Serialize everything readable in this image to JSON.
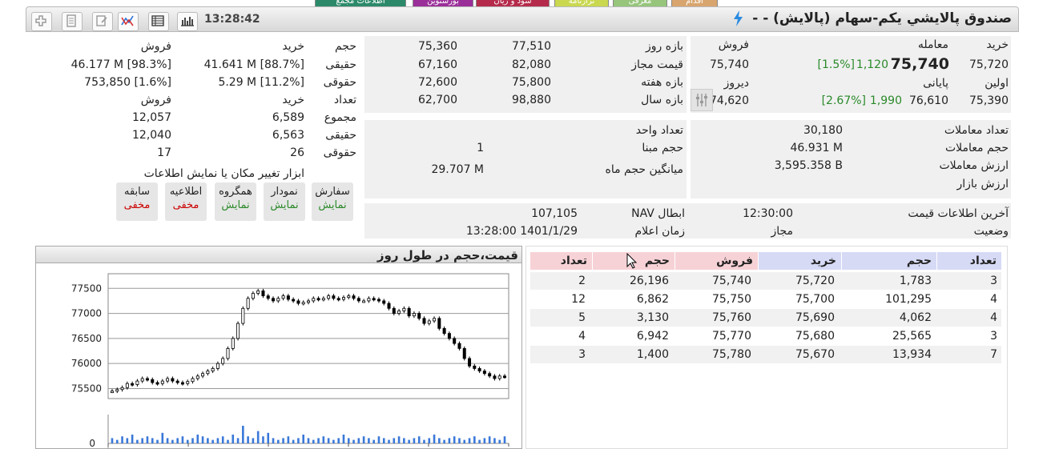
{
  "top_tabs": [
    {
      "label": "اقدام",
      "color": "#d8a56e"
    },
    {
      "label": "معرفی",
      "color": "#96c57b"
    },
    {
      "label": "ترازنامه",
      "color": "#c9d84f"
    },
    {
      "label": "سود و زیان",
      "color": "#b52b4b"
    },
    {
      "label": "بورسنوین",
      "color": "#9b2f9a"
    },
    {
      "label": "اطلاعات مجمع",
      "color": "#2c8a6a"
    }
  ],
  "header": {
    "title": "صندوق پالايشي يكم-سهام (پالايش) - -",
    "time": "13:28:42"
  },
  "price_panel": {
    "buy_label": "خرید",
    "trade_label": "معامله",
    "sell_label": "فروش",
    "buy_price": "75,720",
    "trade_price": "75,740",
    "trade_change": "1,120",
    "trade_pct": "[1.5%]",
    "sell_price": "75,740",
    "first_label": "اولین",
    "last_label": "پایانی",
    "yesterday_label": "دیروز",
    "first_price": "75,390",
    "last_price": "76,610",
    "last_change": "1,990",
    "last_pct": "[2.67%]",
    "yesterday_price": "74,620"
  },
  "ranges": {
    "day_label": "بازه روز",
    "day_low": "75,360",
    "day_high": "77,510",
    "allowed_label": "قیمت مجاز",
    "allowed_low": "67,160",
    "allowed_high": "82,080",
    "week_label": "بازه هفته",
    "week_low": "72,600",
    "week_high": "75,800",
    "year_label": "بازه سال",
    "year_low": "62,700",
    "year_high": "98,880"
  },
  "client_types": {
    "volume_label": "حجم",
    "buy_label": "خرید",
    "sell_label": "فروش",
    "real_label": "حقیقی",
    "legal_label": "حقوقی",
    "count_label": "تعداد",
    "real_buy": "41.641 M [88.7%]",
    "real_sell": "46.177 M [98.3%]",
    "legal_buy": "5.29 M [11.2%]",
    "legal_sell": "753,850 [1.6%]",
    "count_buy_label": "خرید",
    "count_sell_label": "فروش",
    "total_label": "مجموع",
    "total_buy": "6,589",
    "total_sell": "12,057",
    "real2_label": "حقیقی",
    "real_count_buy": "6,563",
    "real_count_sell": "12,040",
    "legal2_label": "حقوقی",
    "legal_count_buy": "26",
    "legal_count_sell": "17"
  },
  "trade_stats": {
    "count_label": "تعداد معاملات",
    "count": "30,180",
    "volume_label": "حجم معاملات",
    "volume": "46.931 M",
    "value_label": "ارزش معاملات",
    "value": "3,595.358 B",
    "market_label": "ارزش بازار"
  },
  "unit_stats": {
    "unit_label": "تعداد واحد",
    "base_label": "حجم مبنا",
    "base": "1",
    "monthavg_label": "میانگین حجم ماه",
    "monthavg": "29.707 M"
  },
  "tools": {
    "title": "ابزار تغییر مکان یا نمایش اطلاعات",
    "buttons": [
      {
        "label": "سفارش",
        "state": "نمایش"
      },
      {
        "label": "نمودار",
        "state": "نمایش"
      },
      {
        "label": "همگروه",
        "state": "نمایش"
      },
      {
        "label": "اطلاعیه",
        "state": "مخفی"
      },
      {
        "label": "سابقه",
        "state": "مخفی"
      }
    ]
  },
  "status": {
    "last_info_label": "آخرین اطلاعات قیمت",
    "last_info": "12:30:00",
    "status_label": "وضعیت",
    "status": "مجاز",
    "nav_label": "NAV ابطال",
    "nav": "107,105",
    "announce_label": "زمان اعلام",
    "announce": "13:28:00 1401/1/29"
  },
  "order_book": {
    "headers": [
      "تعداد",
      "حجم",
      "خرید",
      "فروش",
      "حجم",
      "تعداد"
    ],
    "rows": [
      {
        "buy_count": "3",
        "buy_vol": "1,783",
        "buy_price": "75,720",
        "sell_price": "75,740",
        "sell_vol": "26,196",
        "sell_count": "2"
      },
      {
        "buy_count": "4",
        "buy_vol": "101,295",
        "buy_price": "75,700",
        "sell_price": "75,750",
        "sell_vol": "6,862",
        "sell_count": "12"
      },
      {
        "buy_count": "4",
        "buy_vol": "4,062",
        "buy_price": "75,690",
        "sell_price": "75,760",
        "sell_vol": "3,130",
        "sell_count": "5"
      },
      {
        "buy_count": "3",
        "buy_vol": "25,565",
        "buy_price": "75,680",
        "sell_price": "75,770",
        "sell_vol": "6,942",
        "sell_count": "4"
      },
      {
        "buy_count": "7",
        "buy_vol": "13,934",
        "buy_price": "75,670",
        "sell_price": "75,780",
        "sell_vol": "1,400",
        "sell_count": "3"
      }
    ]
  },
  "chart_data": {
    "type": "line",
    "title": "قیمت،حجم در طول روز",
    "ylim": [
      75300,
      77600
    ],
    "yticks": [
      "77500",
      "77000",
      "76500",
      "76000",
      "75500"
    ],
    "volume_tick": "0",
    "series": [
      {
        "values": [
          75450,
          75480,
          75520,
          75600,
          75580,
          75650,
          75700,
          75680,
          75620,
          75600,
          75650,
          75700,
          75650,
          75620,
          75600,
          75640,
          75700,
          75750,
          75800,
          75850,
          75900,
          76000,
          76100,
          76300,
          76500,
          76800,
          77100,
          77300,
          77400,
          77450,
          77350,
          77300,
          77250,
          77300,
          77350,
          77280,
          77250,
          77200,
          77220,
          77250,
          77300,
          77280,
          77300,
          77350,
          77300,
          77280,
          77320,
          77350,
          77300,
          77250,
          77250,
          77300,
          77280,
          77250,
          77200,
          77100,
          77000,
          77050,
          77100,
          76950,
          77000,
          76900,
          76800,
          76850,
          76900,
          76700,
          76600,
          76500,
          76400,
          76300,
          76100,
          75950,
          75900,
          75850,
          75800,
          75750,
          75700,
          75750,
          75740
        ]
      }
    ],
    "volumes": [
      3,
      2,
      4,
      3,
      5,
      2,
      3,
      4,
      3,
      2,
      6,
      3,
      2,
      3,
      4,
      2,
      3,
      5,
      4,
      3,
      2,
      3,
      4,
      2,
      5,
      3,
      10,
      4,
      3,
      7,
      4,
      6,
      3,
      2,
      3,
      4,
      2,
      3,
      5,
      3,
      2,
      3,
      4,
      3,
      2,
      3,
      5,
      3,
      2,
      3,
      4,
      3,
      2,
      4,
      3,
      2,
      3,
      4,
      3,
      2,
      3,
      4,
      2,
      3,
      5,
      3,
      2,
      3,
      4,
      3,
      2,
      3,
      4,
      2,
      3,
      4,
      3,
      2,
      4
    ]
  }
}
